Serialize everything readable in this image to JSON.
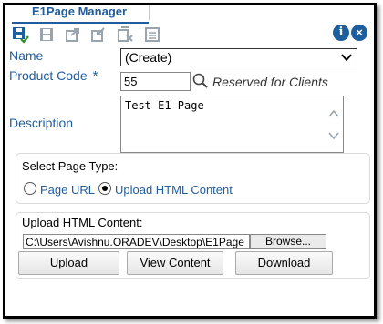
{
  "window": {
    "title": "E1Page Manager"
  },
  "toolbar": {
    "icons": [
      "save-close-icon",
      "save-icon",
      "export-icon",
      "import-icon",
      "delete-icon",
      "form-icon"
    ],
    "info_glyph": "i",
    "close_glyph": "×"
  },
  "form": {
    "name_label": "Name",
    "name_value": "(Create)",
    "product_code_label": "Product Code",
    "required_mark": "*",
    "product_code_value": "55",
    "product_code_hint": "Reserved for Clients",
    "description_label": "Description",
    "description_value": "Test E1 Page"
  },
  "page_type": {
    "title": "Select Page Type:",
    "options": [
      {
        "label": "Page URL",
        "checked": false
      },
      {
        "label": "Upload HTML Content",
        "checked": true
      }
    ]
  },
  "upload": {
    "title": "Upload HTML Content:",
    "path_value": "C:\\Users\\Avishnu.ORADEV\\Desktop\\E1Page",
    "browse_label": "Browse...",
    "upload_label": "Upload",
    "view_label": "View Content",
    "download_label": "Download"
  },
  "colors": {
    "accent": "#1f5d9e",
    "icon_blue": "#1c5e9e",
    "disabled_icon": "#9aa4ae"
  }
}
